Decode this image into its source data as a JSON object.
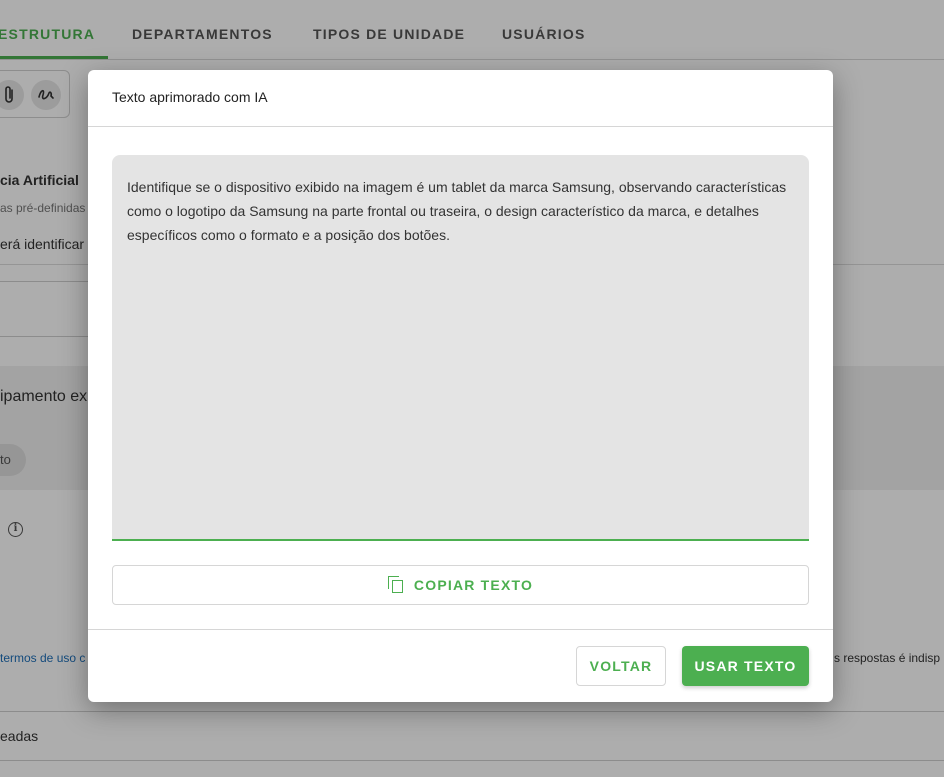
{
  "tabs": [
    {
      "label": "ESTRUTURA",
      "active": true
    },
    {
      "label": "DEPARTAMENTOS",
      "active": false
    },
    {
      "label": "TIPOS DE UNIDADE",
      "active": false
    },
    {
      "label": "USUÁRIOS",
      "active": false
    }
  ],
  "background": {
    "section_title": "cia Artificial",
    "subtitle": "as pré-definidas",
    "description": "erá identificar",
    "equipment_text": "ipamento ex",
    "chip_label": "to",
    "terms_link": "termos de uso c",
    "terms_right": "s respostas é indisp",
    "bottom_label": "eadas"
  },
  "modal": {
    "title": "Texto aprimorado com IA",
    "improved_text": "Identifique se o dispositivo exibido na imagem é um tablet da marca Samsung, observando características como o logotipo da Samsung na parte frontal ou traseira, o design característico da marca, e detalhes específicos como o formato e a posição dos botões.",
    "copy_button": "COPIAR TEXTO",
    "back_button": "VOLTAR",
    "use_button": "USAR TEXTO"
  },
  "colors": {
    "accent": "#4caf50",
    "overlay": "rgba(0,0,0,0.32)"
  },
  "icons": [
    "attachment-icon",
    "signature-icon",
    "info-icon",
    "copy-icon"
  ]
}
